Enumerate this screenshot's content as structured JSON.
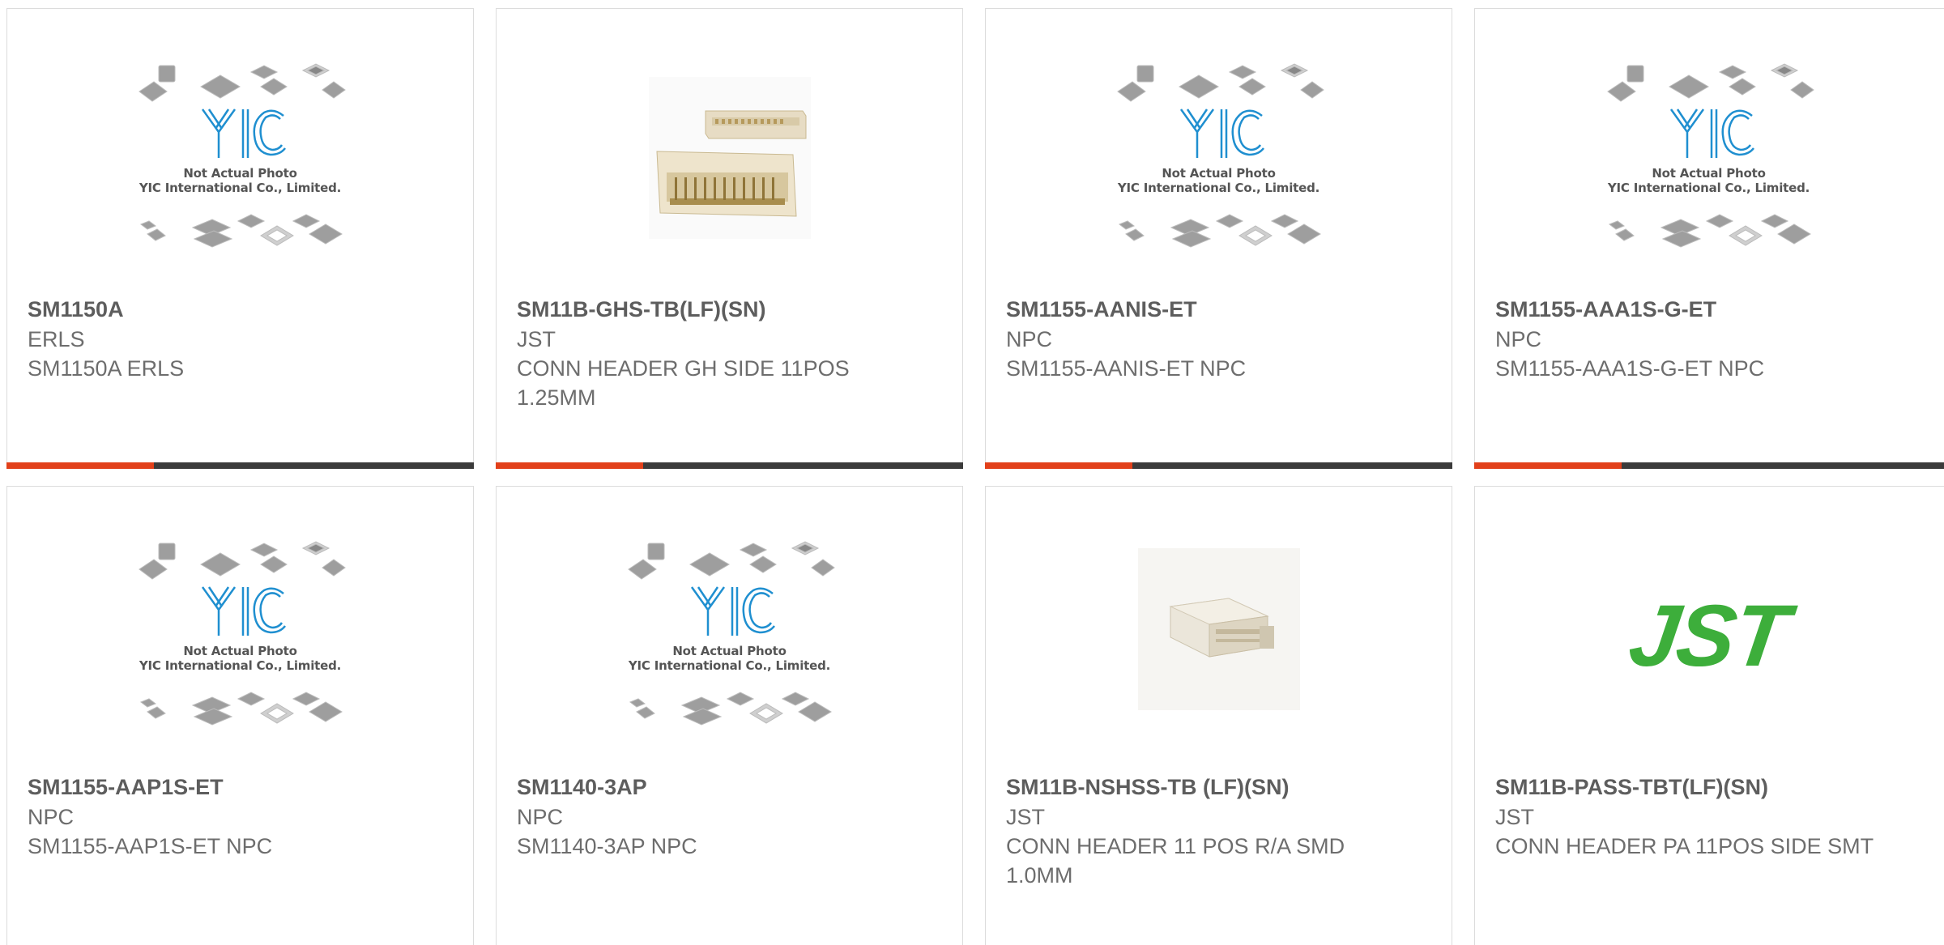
{
  "placeholder": {
    "caption_line1": "Not Actual Photo",
    "caption_line2": "YIC International Co., Limited.",
    "logo_text": "YIC"
  },
  "cards": [
    {
      "part": "SM1150A",
      "maker": "ERLS",
      "desc": "SM1150A ERLS",
      "image": "yic-placeholder"
    },
    {
      "part": "SM11B-GHS-TB(LF)(SN)",
      "maker": "JST",
      "desc": "CONN HEADER GH SIDE 11POS 1.25MM",
      "image": "connector-photo"
    },
    {
      "part": "SM1155-AANIS-ET",
      "maker": "NPC",
      "desc": "SM1155-AANIS-ET NPC",
      "image": "yic-placeholder"
    },
    {
      "part": "SM1155-AAA1S-G-ET",
      "maker": "NPC",
      "desc": "SM1155-AAA1S-G-ET NPC",
      "image": "yic-placeholder"
    },
    {
      "part": "SM1155-AAP1S-ET",
      "maker": "NPC",
      "desc": "SM1155-AAP1S-ET NPC",
      "image": "yic-placeholder"
    },
    {
      "part": "SM1140-3AP",
      "maker": "NPC",
      "desc": "SM1140-3AP NPC",
      "image": "yic-placeholder"
    },
    {
      "part": "SM11B-NSHSS-TB (LF)(SN)",
      "maker": "JST",
      "desc": "CONN HEADER 11 POS R/A SMD 1.0MM",
      "image": "connector-photo-small"
    },
    {
      "part": "SM11B-PASS-TBT(LF)(SN)",
      "maker": "JST",
      "desc": "CONN HEADER PA 11POS SIDE SMT",
      "image": "jst-logo"
    }
  ],
  "jst_logo_text": "JST",
  "colors": {
    "accent": "#e2401a",
    "bar": "#3b3b3b",
    "yic_blue": "#1f8fd0",
    "jst_green": "#3dae3b",
    "title_text": "#5d5d5d",
    "body_text": "#6d6d6d"
  }
}
